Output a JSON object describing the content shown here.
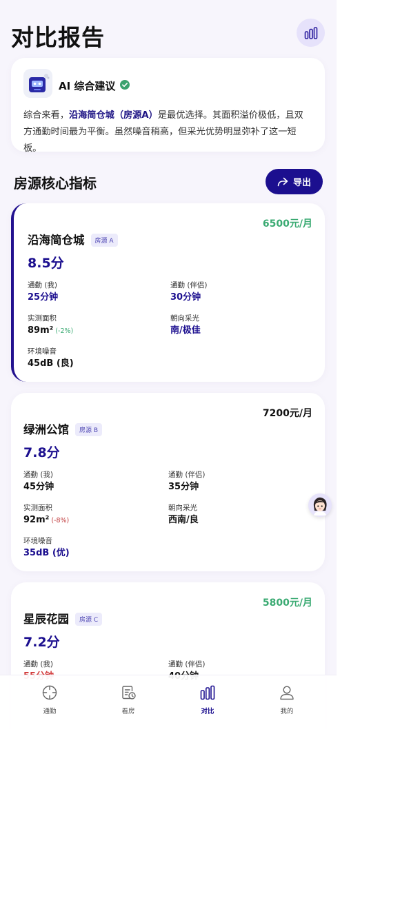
{
  "header": {
    "title": "对比报告",
    "chart_btn_icon": "bar-chart-icon"
  },
  "ai": {
    "title": "AI 综合建议",
    "summary_pre": "综合来看，",
    "summary_hl": "沿海简仓城（房源A）",
    "summary_post": "是最优选择。其面积溢价极低，且双方通勤时间最为平衡。虽然噪音稍高，但采光优势明显弥补了这一短板。"
  },
  "section": {
    "title": "房源核心指标",
    "export_label": "导出"
  },
  "listings": [
    {
      "price": "6500元/月",
      "name": "沿海简仓城",
      "tag": "房源 A",
      "score": "8.5分",
      "commute_me_label": "通勤 (我)",
      "commute_me": "25分钟",
      "commute_partner_label": "通勤 (伴侣)",
      "commute_partner": "30分钟",
      "area_label": "实测面积",
      "area": "89m²",
      "area_note": "(-2%)",
      "light_label": "朝向采光",
      "light": "南/极佳",
      "noise_label": "环境噪音",
      "noise": "45dB (良)"
    },
    {
      "price": "7200元/月",
      "name": "绿洲公馆",
      "tag": "房源 B",
      "score": "7.8分",
      "commute_me_label": "通勤 (我)",
      "commute_me": "45分钟",
      "commute_partner_label": "通勤 (伴侣)",
      "commute_partner": "35分钟",
      "area_label": "实测面积",
      "area": "92m²",
      "area_note": "(-8%)",
      "light_label": "朝向采光",
      "light": "西南/良",
      "noise_label": "环境噪音",
      "noise": "35dB (优)"
    },
    {
      "price": "5800元/月",
      "name": "星辰花园",
      "tag": "房源 C",
      "score": "7.2分",
      "commute_me_label": "通勤 (我)",
      "commute_me": "55分钟",
      "commute_partner_label": "通勤 (伴侣)",
      "commute_partner": "40分钟"
    }
  ],
  "nav": [
    {
      "label": "通勤",
      "icon": "crosshair-icon"
    },
    {
      "label": "看房",
      "icon": "document-clock-icon"
    },
    {
      "label": "对比",
      "icon": "bar-chart-icon"
    },
    {
      "label": "我的",
      "icon": "user-icon"
    }
  ],
  "colors": {
    "accent": "#1c0f8f",
    "price_green": "#3aaa72",
    "note_green": "#3aaa72",
    "note_red": "#c0393b",
    "warn": "#d23a3a"
  }
}
